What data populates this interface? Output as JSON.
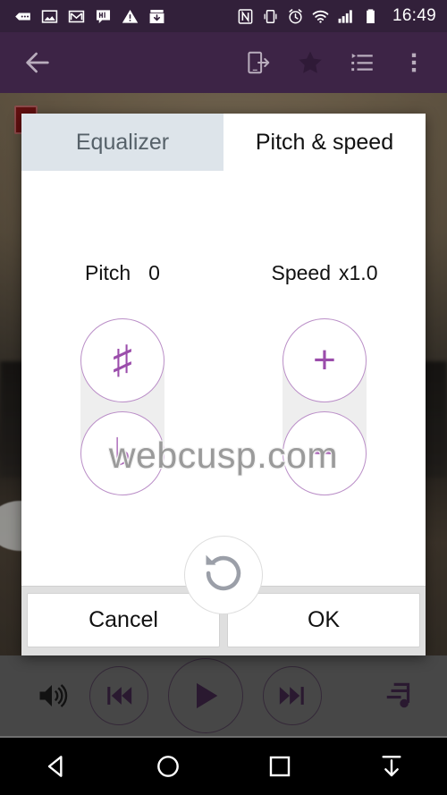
{
  "statusbar": {
    "icons_left": [
      "messaging-icon",
      "gallery-icon",
      "gmail-icon",
      "hike-icon",
      "warning-icon",
      "download-manager-icon"
    ],
    "icons_right": [
      "nfc-icon",
      "vibrate-icon",
      "alarm-icon",
      "wifi-icon",
      "signal-icon",
      "battery-icon"
    ],
    "clock": "16:49"
  },
  "toolbar": {
    "back_icon": "arrow-left-icon",
    "actions": [
      "cast-to-device-icon",
      "favorite-star-icon",
      "playlist-queue-icon",
      "overflow-menu-icon"
    ]
  },
  "dialog": {
    "tabs": [
      {
        "label": "Equalizer",
        "active": false
      },
      {
        "label": "Pitch & speed",
        "active": true
      }
    ],
    "pitch": {
      "label": "Pitch",
      "value": "0",
      "up_symbol": "♯",
      "down_symbol": "♭",
      "up_name": "pitch-sharp-button",
      "down_name": "pitch-flat-button"
    },
    "speed": {
      "label": "Speed",
      "value": "x1.0",
      "up_symbol": "+",
      "down_symbol": "−",
      "up_name": "speed-increase-button",
      "down_name": "speed-decrease-button"
    },
    "reset_icon": "reset-rotate-ccw-icon",
    "buttons": {
      "cancel": "Cancel",
      "ok": "OK"
    }
  },
  "watermark": {
    "text": "webcusp.com"
  },
  "player": {
    "volume_icon": "volume-up-icon",
    "previous_icon": "skip-previous-icon",
    "play_icon": "play-icon",
    "next_icon": "skip-next-icon",
    "equalizer_icon": "music-equalizer-icon"
  },
  "navbar": {
    "items": [
      "back-triangle-icon",
      "home-circle-icon",
      "recents-square-icon",
      "hide-navbar-down-icon"
    ]
  },
  "colors": {
    "status_bar": "#32203a",
    "toolbar": "#3d2446",
    "accent_purple": "#9b4dab",
    "tab_inactive_bg": "#dde4ea",
    "player_bar": "#666666",
    "footer_bg": "#dfdfdf",
    "watermark": "#9a9a9a"
  }
}
